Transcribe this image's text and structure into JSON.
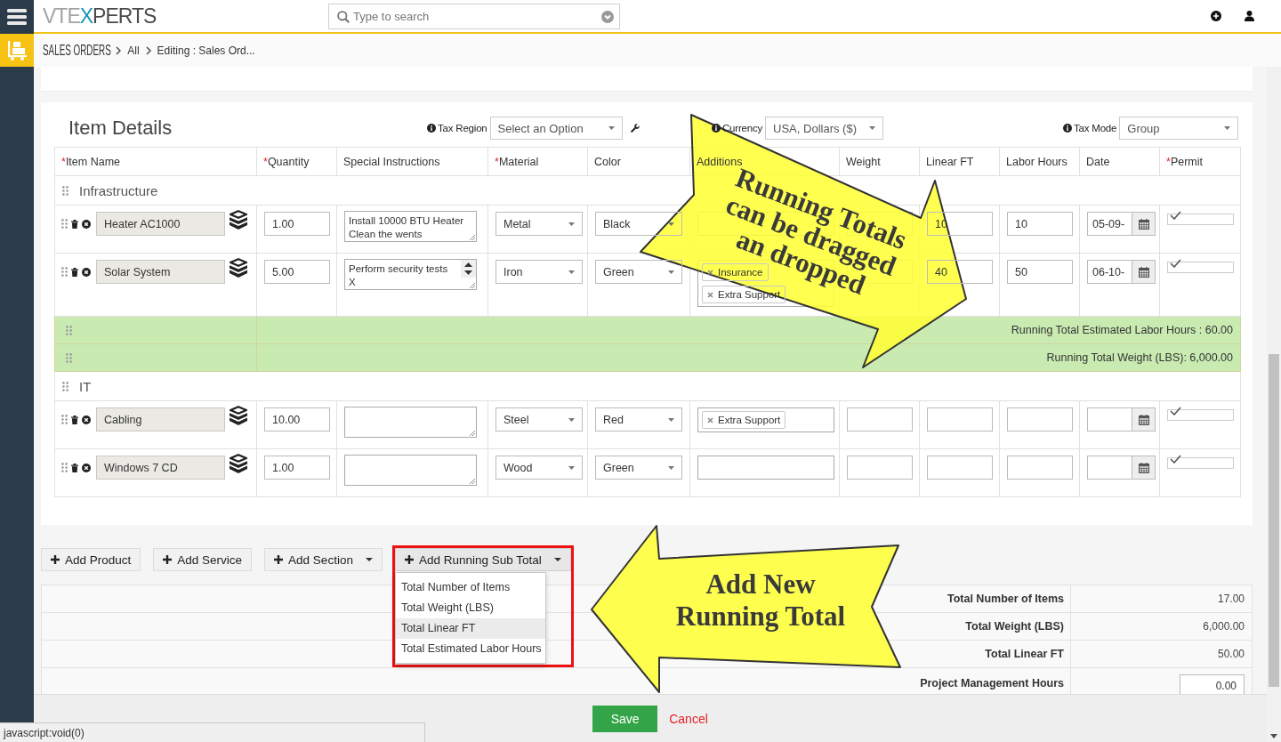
{
  "header": {
    "logo": [
      {
        "text": "VTE",
        "color": "#a3a3a3"
      },
      {
        "text": "X",
        "color": "#1693b5"
      },
      {
        "text": "PERTS",
        "color": "#4a4a4a"
      }
    ],
    "search": {
      "placeholder": "Type to search"
    }
  },
  "breadcrumb": {
    "module": "SALES ORDERS",
    "items": [
      {
        "label": "All"
      },
      {
        "label": "Editing : Sales Ord..."
      }
    ]
  },
  "item_details": {
    "title": "Item Details",
    "settings": [
      {
        "label": "Tax Region",
        "value": "Select an Option",
        "tool": true
      },
      {
        "label": "Currency",
        "value": "USA, Dollars ($)",
        "tool": false
      },
      {
        "label": "Tax Mode",
        "value": "Group",
        "tool": false
      }
    ],
    "columns": [
      {
        "mark": "*",
        "label": "Item Name"
      },
      {
        "mark": "*",
        "label": "Quantity"
      },
      {
        "label": "Special Instructions"
      },
      {
        "mark": "*",
        "label": "Material"
      },
      {
        "label": "Color"
      },
      {
        "label": "Additions"
      },
      {
        "label": "Weight"
      },
      {
        "label": "Linear FT"
      },
      {
        "label": "Labor Hours"
      },
      {
        "label": "Date"
      },
      {
        "mark": "*",
        "label": "Permit"
      }
    ],
    "rows": [
      {
        "kind": "section",
        "title": "Infrastructure"
      },
      {
        "kind": "item",
        "name": "Heater AC1000",
        "quantity": "1.00",
        "instructions": "Install 10000 BTU Heater\nClean the wents",
        "scrollable": false,
        "material": "Metal",
        "color_option": "Black",
        "linear_ft": "10",
        "labor_hours": "10",
        "date": "05-09-",
        "permit": true
      },
      {
        "kind": "item",
        "name": "Solar System",
        "quantity": "5.00",
        "instructions": "Perform security tests\nX",
        "scrollable": true,
        "material": "Iron",
        "color_option": "Green",
        "additions": [
          "Insurance",
          "Extra Support"
        ],
        "linear_ft": "40",
        "labor_hours": "50",
        "date": "06-10-",
        "permit": true
      },
      {
        "kind": "running_total",
        "text": "Running Total Estimated Labor Hours : 60.00"
      },
      {
        "kind": "running_total",
        "text": "Running Total Weight (LBS): 6,000.00"
      },
      {
        "kind": "section",
        "title": "IT"
      },
      {
        "kind": "item",
        "name": "Cabling",
        "quantity": "10.00",
        "scrollable": false,
        "material": "Steel",
        "color_option": "Red",
        "additions": [
          "Extra Support"
        ],
        "permit": true
      },
      {
        "kind": "item",
        "name": "Windows 7 CD",
        "quantity": "1.00",
        "scrollable": false,
        "material": "Wood",
        "color_option": "Green",
        "permit": true
      }
    ]
  },
  "actions": [
    {
      "label": "Add Product",
      "kind": "plain",
      "highlighted": false
    },
    {
      "label": "Add Service",
      "kind": "plain",
      "highlighted": false
    },
    {
      "label": "Add Section",
      "kind": "dropdown",
      "expanded": false,
      "highlighted": false
    },
    {
      "label": "Add Running Sub Total",
      "kind": "dropdown",
      "expanded": true,
      "highlighted": true,
      "menu": [
        {
          "label": "Total Number of Items",
          "selected": false
        },
        {
          "label": "Total Weight (LBS)",
          "selected": false
        },
        {
          "label": "Total Linear FT",
          "selected": true
        },
        {
          "label": "Total Estimated Labor Hours",
          "selected": false
        }
      ]
    }
  ],
  "totals": [
    {
      "kind": "value",
      "label": "Total Number of Items",
      "value": "17.00"
    },
    {
      "kind": "value",
      "label": "Total Weight (LBS)",
      "value": "6,000.00"
    },
    {
      "kind": "value",
      "label": "Total Linear FT",
      "value": "50.00"
    },
    {
      "kind": "input",
      "label": "Project Management Hours",
      "value": "0.00"
    }
  ],
  "footer": {
    "save": "Save",
    "cancel": "Cancel"
  },
  "status_url": "javascript:void(0)",
  "callouts": [
    {
      "text": "Running Totals\ncan be dragged\nan dropped"
    },
    {
      "text": "Add New\nRunning Total"
    }
  ]
}
